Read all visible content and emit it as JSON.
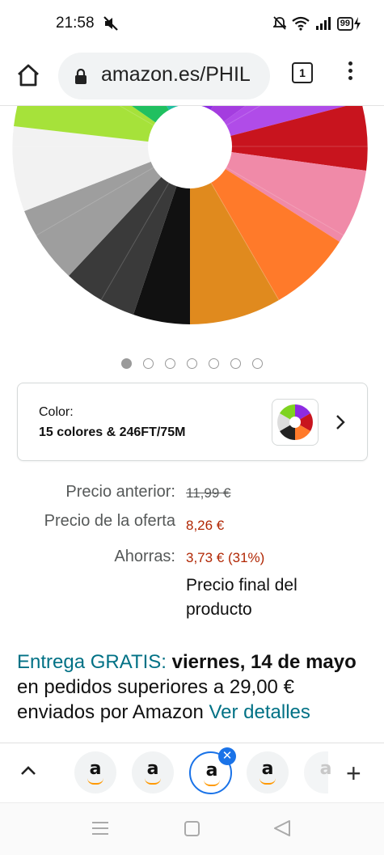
{
  "status_bar": {
    "time": "21:58",
    "battery": "99"
  },
  "browser": {
    "url": "amazon.es/PHIL",
    "tab_count": "1"
  },
  "product": {
    "carousel": {
      "image_count": 7,
      "active_index": 0
    },
    "color_selector": {
      "label": "Color:",
      "value": "15 colores & 246FT/75M"
    },
    "prices": {
      "previous_label": "Precio anterior:",
      "previous_value": "11,99 €",
      "offer_label": "Precio de la oferta",
      "offer_value": "8,26 €",
      "savings_label": "Ahorras:",
      "savings_value": "3,73 € (31%)",
      "final_note": "Precio final del producto"
    },
    "delivery": {
      "prefix": "Entrega GRATIS:",
      "date": "viernes, 14 de mayo",
      "middle": "en pedidos superiores a 29,00 € enviados por Amazon",
      "link": "Ver detalles"
    }
  },
  "tab_strip": {
    "tabs": [
      {
        "letter": "a",
        "selected": false
      },
      {
        "letter": "a",
        "selected": false
      },
      {
        "letter": "a",
        "selected": true
      },
      {
        "letter": "a",
        "selected": false
      }
    ]
  },
  "colors": {
    "price_red": "#b12704",
    "link_teal": "#007185",
    "tab_selected_blue": "#1a73e8",
    "amazon_orange": "#ff9900"
  }
}
